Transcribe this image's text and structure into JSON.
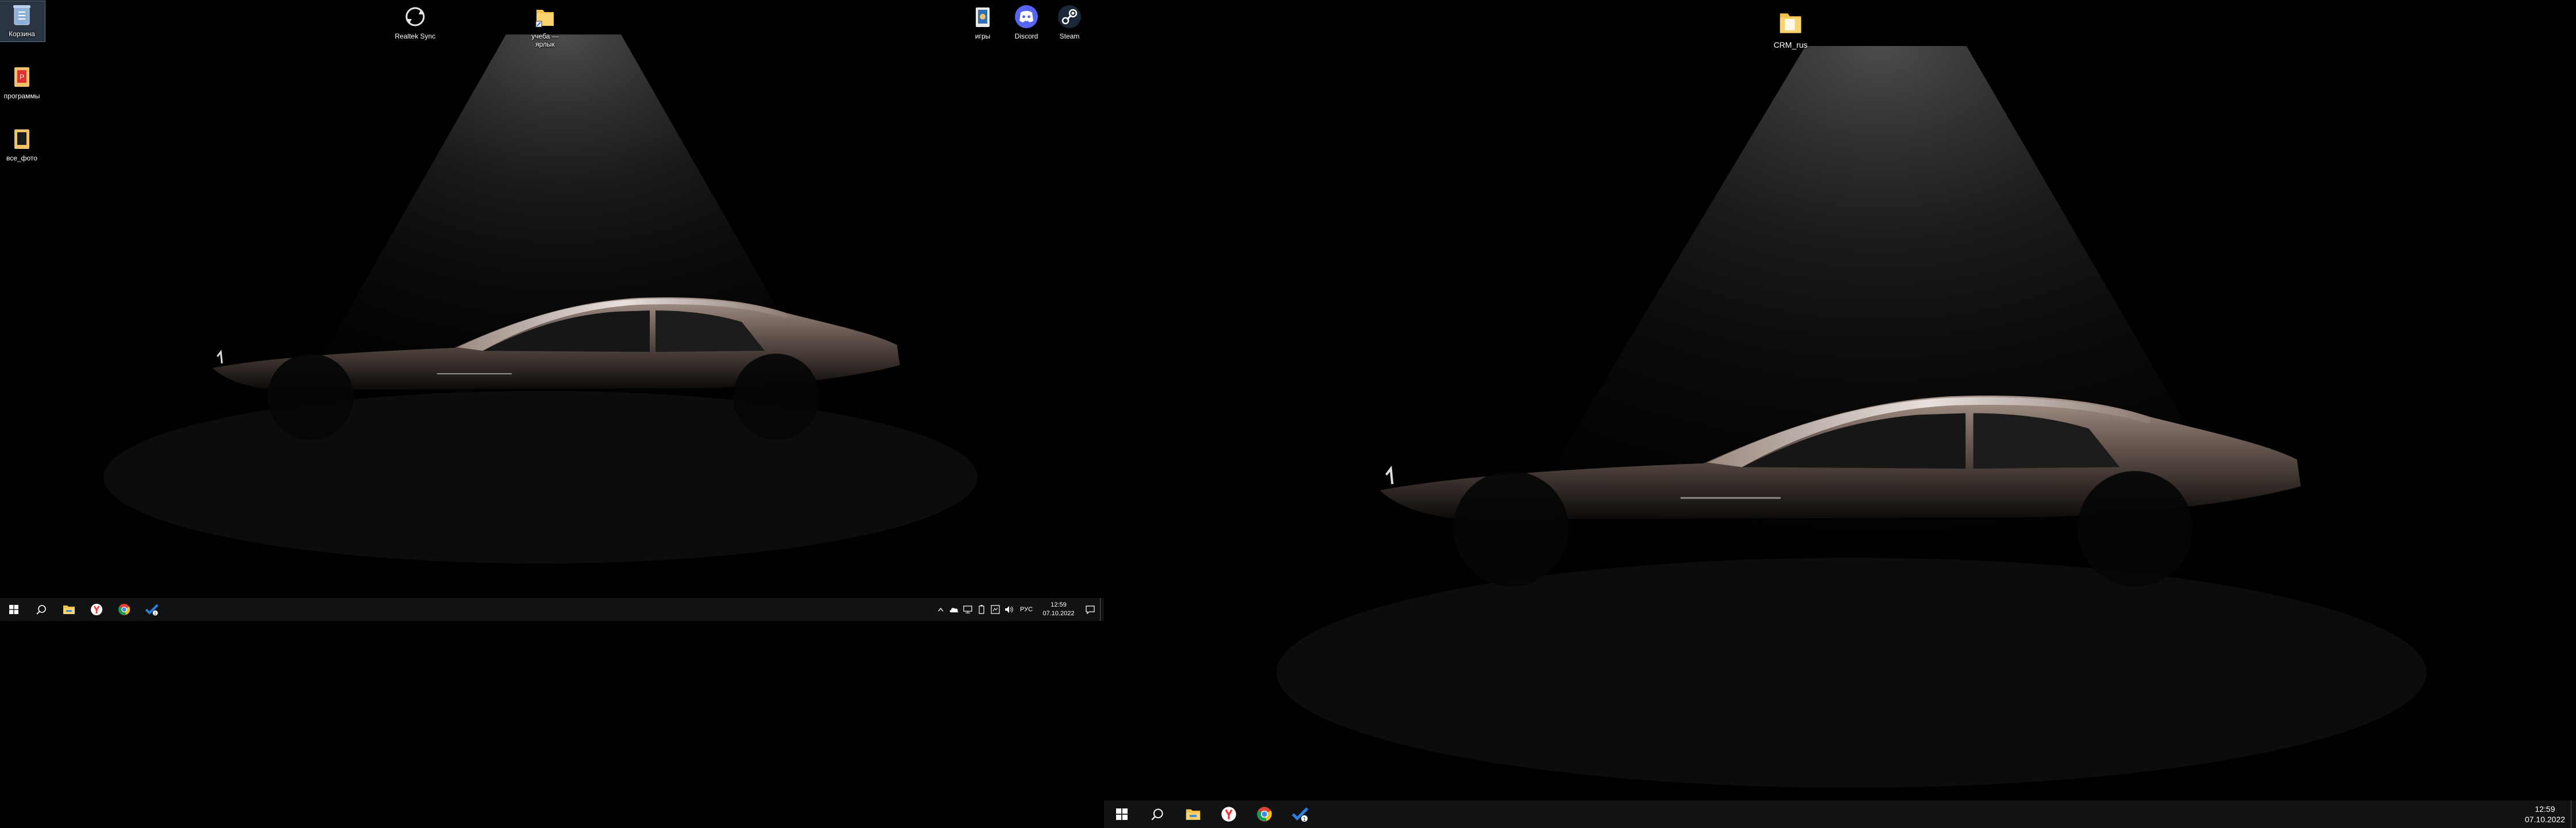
{
  "monitor1": {
    "desktop_icons": [
      {
        "label": "Корзина",
        "icon": "recycle-bin-icon"
      },
      {
        "label": "программы",
        "icon": "folder-programs-icon"
      },
      {
        "label": "все_фото",
        "icon": "folder-photos-icon"
      },
      {
        "label": "Realtek Sync",
        "icon": "sync-icon"
      },
      {
        "label": "учеба —\nярлык",
        "icon": "folder-shortcut-icon"
      },
      {
        "label": "игры",
        "icon": "games-folder-icon"
      },
      {
        "label": "Discord",
        "icon": "discord-icon"
      },
      {
        "label": "Steam",
        "icon": "steam-icon"
      }
    ],
    "taskbar": {
      "pinned": [
        "start-icon",
        "search-icon",
        "file-explorer-icon",
        "yandex-browser-icon",
        "chrome-icon",
        "todo-icon"
      ],
      "tray": {
        "icons": [
          "chevron-up-icon",
          "onedrive-icon",
          "network-icon",
          "battery-icon",
          "app-tray-icon",
          "volume-icon"
        ],
        "language": "РУС",
        "time": "12:59",
        "date": "07.10.2022"
      }
    }
  },
  "monitor2": {
    "desktop_icons": [
      {
        "label": "CRM_rus",
        "icon": "folder-crm-icon"
      }
    ],
    "taskbar": {
      "pinned": [
        "start-icon",
        "search-icon",
        "file-explorer-icon",
        "yandex-browser-icon",
        "chrome-icon",
        "todo-icon"
      ],
      "tray": {
        "time": "12:59",
        "date": "07.10.2022"
      }
    }
  },
  "colors": {
    "taskbar": "#111214",
    "desktop_background": "#000000",
    "car_body": "#6e5c55",
    "accent_blue": "#2f7fe0"
  }
}
